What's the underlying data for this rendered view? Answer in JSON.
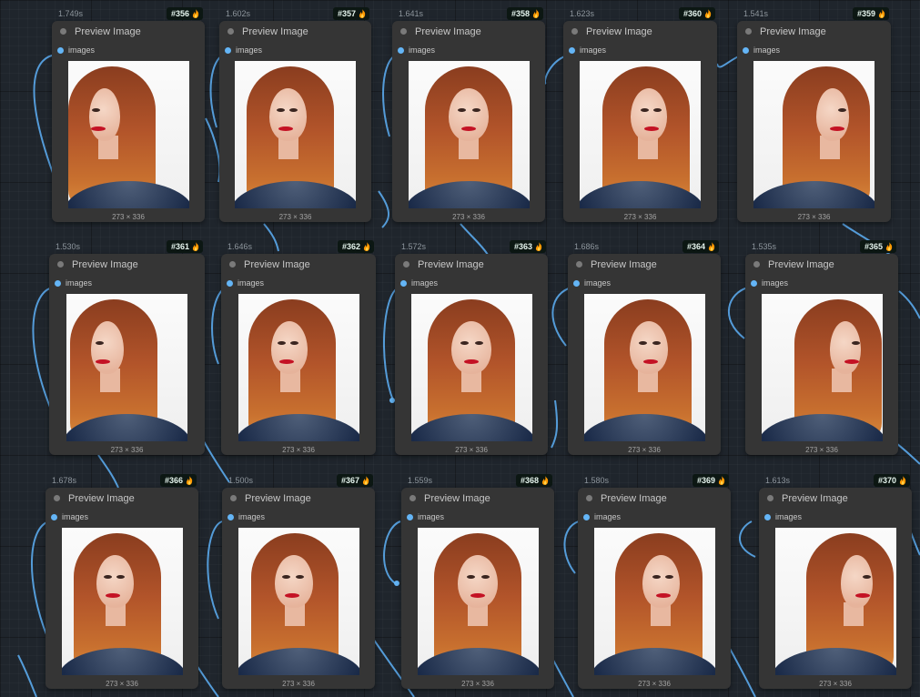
{
  "node_title": "Preview Image",
  "port_label": "images",
  "accent": "#64b5f6",
  "nodes": [
    {
      "id": "#356",
      "time": "1.749s",
      "dims": "273 × 336"
    },
    {
      "id": "#357",
      "time": "1.602s",
      "dims": "273 × 336"
    },
    {
      "id": "#358",
      "time": "1.641s",
      "dims": "273 × 336"
    },
    {
      "id": "#360",
      "time": "1.623s",
      "dims": "273 × 336"
    },
    {
      "id": "#359",
      "time": "1.541s",
      "dims": "273 × 336"
    },
    {
      "id": "#361",
      "time": "1.530s",
      "dims": "273 × 336"
    },
    {
      "id": "#362",
      "time": "1.646s",
      "dims": "273 × 336"
    },
    {
      "id": "#363",
      "time": "1.572s",
      "dims": "273 × 336"
    },
    {
      "id": "#364",
      "time": "1.686s",
      "dims": "273 × 336"
    },
    {
      "id": "#365",
      "time": "1.535s",
      "dims": "273 × 336"
    },
    {
      "id": "#366",
      "time": "1.678s",
      "dims": "273 × 336"
    },
    {
      "id": "#367",
      "time": "1.500s",
      "dims": "273 × 336"
    },
    {
      "id": "#368",
      "time": "1.559s",
      "dims": "273 × 336"
    },
    {
      "id": "#369",
      "time": "1.580s",
      "dims": "273 × 336"
    },
    {
      "id": "#370",
      "time": "1.613s",
      "dims": "273 × 336"
    }
  ]
}
